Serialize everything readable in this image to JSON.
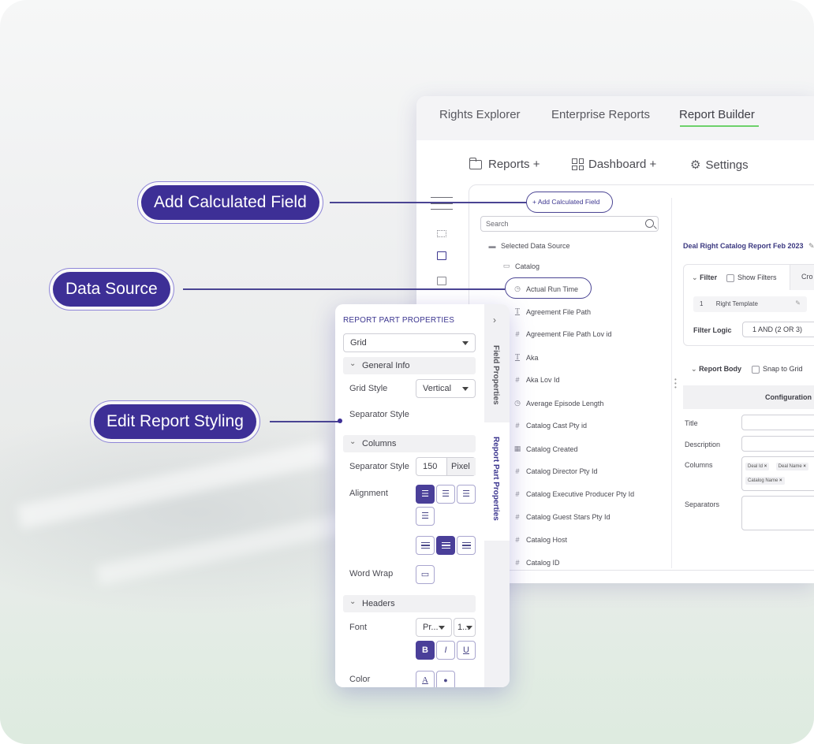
{
  "tabs": [
    {
      "label": "Rights Explorer"
    },
    {
      "label": "Enterprise Reports"
    },
    {
      "label": "Report Builder"
    }
  ],
  "menu": {
    "reports": "Reports +",
    "dashboard": "Dashboard +",
    "settings": "Settings"
  },
  "data_source": {
    "add_calc_button": "+ Add Calculated Field",
    "search_placeholder": "Search",
    "selected_label": "Selected Data Source",
    "catalog_label": "Catalog",
    "fields": [
      {
        "icon": "clock-icon",
        "glyph": "◷",
        "label": "Actual Run Time"
      },
      {
        "icon": "text-icon",
        "glyph": "T",
        "label": "Agreement File Path"
      },
      {
        "icon": "hash-icon",
        "glyph": "#",
        "label": "Agreement File Path Lov id"
      },
      {
        "icon": "text-icon",
        "glyph": "T",
        "label": "Aka"
      },
      {
        "icon": "hash-icon",
        "glyph": "#",
        "label": "Aka Lov Id"
      },
      {
        "icon": "clock-icon",
        "glyph": "◷",
        "label": "Average Episode Length"
      },
      {
        "icon": "hash-icon",
        "glyph": "#",
        "label": "Catalog Cast Pty id"
      },
      {
        "icon": "calendar-icon",
        "glyph": "▦",
        "label": "Catalog Created"
      },
      {
        "icon": "hash-icon",
        "glyph": "#",
        "label": "Catalog Director Pty Id"
      },
      {
        "icon": "hash-icon",
        "glyph": "#",
        "label": "Catalog Executive Producer Pty Id"
      },
      {
        "icon": "hash-icon",
        "glyph": "#",
        "label": "Catalog Guest Stars Pty Id"
      },
      {
        "icon": "hash-icon",
        "glyph": "#",
        "label": "Catalog Host"
      },
      {
        "icon": "hash-icon",
        "glyph": "#",
        "label": "Catalog ID"
      }
    ]
  },
  "report": {
    "title": "Deal Right Catalog Report Feb 2023",
    "filter_label": "Filter",
    "show_filters": "Show Filters",
    "cro_tab": "Cro",
    "template_row_num": "1",
    "template_row_label": "Right Template",
    "filter_logic_label": "Filter Logic",
    "filter_logic_value": "1 AND (2 OR 3)",
    "report_body_label": "Report Body",
    "snap_to_grid": "Snap to Grid",
    "configuration": "Configuration",
    "title_field": "Title",
    "description_field": "Description",
    "columns_field": "Columns",
    "separators_field": "Separators",
    "column_chips": [
      "Deal Id",
      "Deal Name",
      "Catalog Name"
    ]
  },
  "properties": {
    "title": "REPORT PART PROPERTIES",
    "part_type": "Grid",
    "side_tab_field": "Field Properties",
    "side_tab_report": "Report Part Properties",
    "general_info": "General Info",
    "grid_style_label": "Grid Style",
    "grid_style_value": "Vertical",
    "separator_style_label": "Separator Style",
    "columns_section": "Columns",
    "col_separator_label": "Separator Style",
    "col_separator_value": "150",
    "col_separator_unit": "Pixel",
    "alignment_label": "Alignment",
    "word_wrap_label": "Word Wrap",
    "headers_section": "Headers",
    "font_label": "Font",
    "font_family_value": "Pr...",
    "font_size_value": "1...",
    "bold": "B",
    "italic": "I",
    "underline": "U",
    "color_label": "Color",
    "color_text_glyph": "A",
    "color_fill_glyph": "●"
  },
  "callouts": {
    "add_calculated_field": "Add Calculated Field",
    "data_source": "Data Source",
    "edit_report_styling": "Edit Report Styling"
  },
  "colors": {
    "accent": "#3d2f96",
    "active_tab_underline": "#6dd16b"
  }
}
